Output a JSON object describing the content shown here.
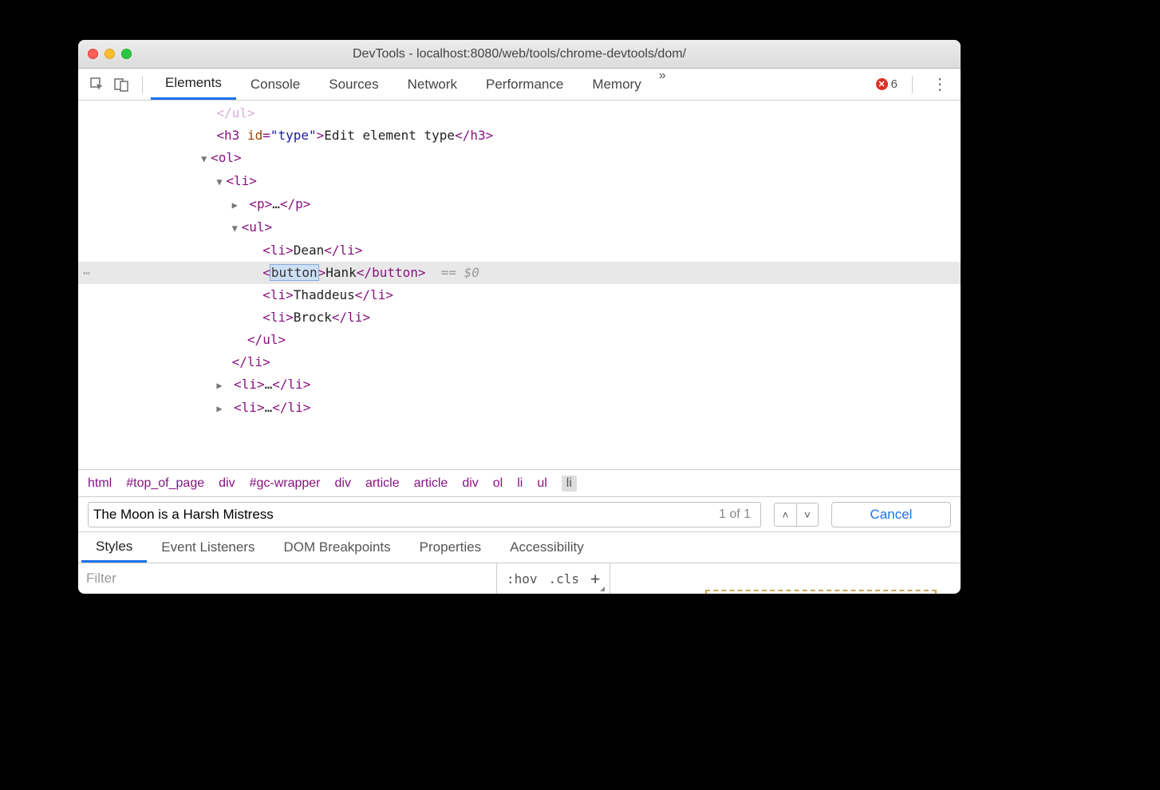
{
  "window_title": "DevTools - localhost:8080/web/tools/chrome-devtools/dom/",
  "tabs": [
    "Elements",
    "Console",
    "Sources",
    "Network",
    "Performance",
    "Memory"
  ],
  "active_tab": "Elements",
  "error_count": "6",
  "dom": {
    "faded_close": "</ul>",
    "h3_id": "type",
    "h3_text": "Edit element type",
    "li1": "Dean",
    "edit_tag": "button",
    "edit_text": "Hank",
    "edit_close": "button",
    "eq0": "== $0",
    "li3": "Thaddeus",
    "li4": "Brock"
  },
  "breadcrumbs": [
    "html",
    "#top_of_page",
    "div",
    "#gc-wrapper",
    "div",
    "article",
    "article",
    "div",
    "ol",
    "li",
    "ul",
    "li"
  ],
  "search": {
    "value": "The Moon is a Harsh Mistress",
    "count": "1 of 1",
    "cancel": "Cancel"
  },
  "subtabs": [
    "Styles",
    "Event Listeners",
    "DOM Breakpoints",
    "Properties",
    "Accessibility"
  ],
  "filter": {
    "placeholder": "Filter",
    "hov": ":hov",
    "cls": ".cls"
  }
}
